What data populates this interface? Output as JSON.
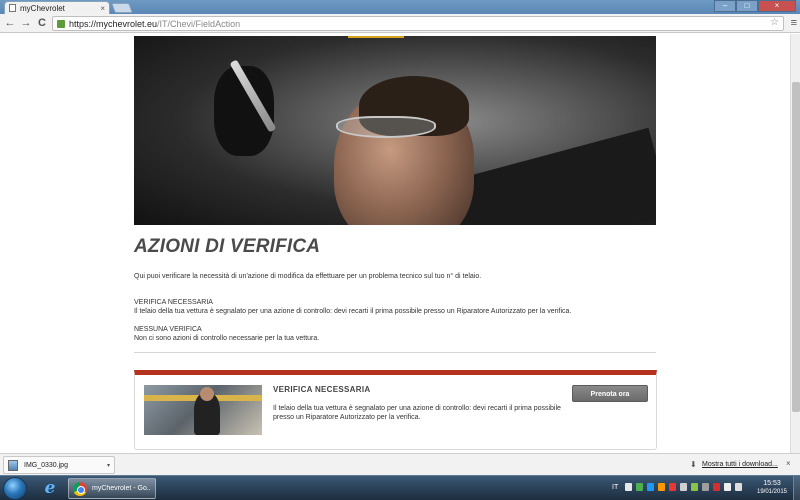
{
  "browser": {
    "tab_title": "myChevrolet",
    "tab_close": "×",
    "url_host": "https://mychevrolet.eu",
    "url_path": "/IT/Chevi/FieldAction",
    "nav": {
      "back": "←",
      "forward": "→",
      "reload": "C"
    },
    "star": "☆",
    "menu": "≡",
    "window": {
      "minimize": "–",
      "maximize": "□",
      "close": "×"
    }
  },
  "page": {
    "title": "AZIONI DI VERIFICA",
    "intro": "Qui puoi verificare la necessità di un'azione di modifica da effettuare per un problema tecnico sul tuo n° di telaio.",
    "legend": [
      {
        "title": "VERIFICA NECESSARIA",
        "text": "Il telaio della tua vettura è segnalato per una azione di controllo: devi recarti il prima possibile presso un Riparatore Autorizzato per la verifica."
      },
      {
        "title": "NESSUNA VERIFICA",
        "text": "Non ci sono azioni di controllo necessarie per la tua vettura."
      }
    ],
    "card": {
      "title": "VERIFICA NECESSARIA",
      "text": "Il telaio della tua vettura è segnalato per una azione di controllo: devi recarti il prima possibile presso un Riparatore Autorizzato per la verifica.",
      "button": "Prenota ora"
    }
  },
  "downloads": {
    "item": "IMG_0330.jpg",
    "caret": "▾",
    "show_all": "Mostra tutti i download...",
    "close": "×"
  },
  "taskbar": {
    "chrome_label": "myChevrolet - Go...",
    "ie_glyph": "e",
    "language": "IT",
    "time": "15:53",
    "date": "19/01/2015"
  },
  "colors": {
    "accent_red": "#b5321e",
    "hero_accent": "#d5a11e",
    "button_gray": "#7a7a7a"
  }
}
